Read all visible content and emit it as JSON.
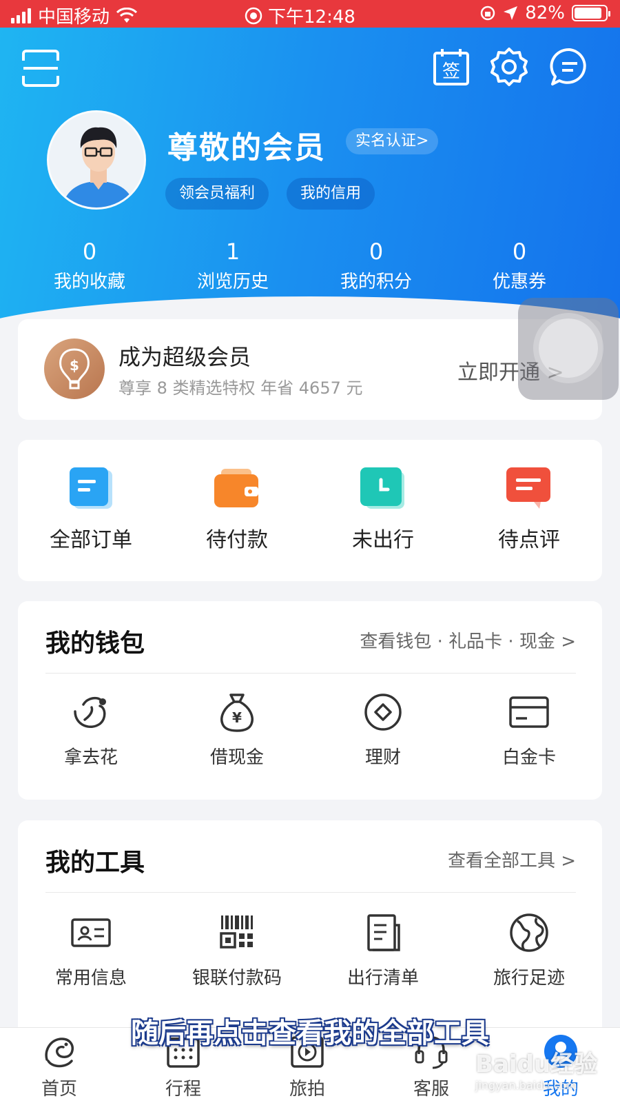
{
  "status_bar": {
    "carrier": "中国移动",
    "time": "下午12:48",
    "battery": "82%",
    "battery_level": 0.82
  },
  "header": {
    "scan_icon": "scan-icon",
    "sign_icon_label": "签",
    "username": "尊敬的会员",
    "realname_badge": "实名认证>",
    "pills": [
      "领会员福利",
      "我的信用"
    ],
    "stats": [
      {
        "value": "0",
        "label": "我的收藏"
      },
      {
        "value": "1",
        "label": "浏览历史"
      },
      {
        "value": "0",
        "label": "我的积分"
      },
      {
        "value": "0",
        "label": "优惠券"
      }
    ],
    "colors": {
      "gradient_start": "#1fb5f2",
      "gradient_end": "#1472ec",
      "status_bar": "#e8383d"
    }
  },
  "vip": {
    "title": "成为超级会员",
    "subtitle": "尊享 8 类精选特权 年省 4657 元",
    "action": "立即开通 >"
  },
  "orders": [
    {
      "label": "全部订单",
      "icon": "order-list-icon",
      "color": "#2aa4f4"
    },
    {
      "label": "待付款",
      "icon": "wallet-icon",
      "color": "#f7862a"
    },
    {
      "label": "未出行",
      "icon": "clock-icon",
      "color": "#1fc7b6"
    },
    {
      "label": "待点评",
      "icon": "comment-icon",
      "color": "#f0503c"
    }
  ],
  "wallet": {
    "title": "我的钱包",
    "link": "查看钱包 · 礼品卡 · 现金 >",
    "items": [
      {
        "label": "拿去花",
        "icon": "naquhua-icon"
      },
      {
        "label": "借现金",
        "icon": "money-bag-icon"
      },
      {
        "label": "理财",
        "icon": "finance-icon"
      },
      {
        "label": "白金卡",
        "icon": "card-icon"
      }
    ]
  },
  "tools": {
    "title": "我的工具",
    "link": "查看全部工具 >",
    "items": [
      {
        "label": "常用信息",
        "icon": "id-card-icon"
      },
      {
        "label": "银联付款码",
        "icon": "qr-code-icon"
      },
      {
        "label": "出行清单",
        "icon": "checklist-icon"
      },
      {
        "label": "旅行足迹",
        "icon": "globe-icon"
      }
    ]
  },
  "subtitle_overlay": "随后再点击查看我的全部工具",
  "tabbar": [
    {
      "label": "首页",
      "icon": "dolphin-icon"
    },
    {
      "label": "行程",
      "icon": "calendar-icon"
    },
    {
      "label": "旅拍",
      "icon": "video-icon"
    },
    {
      "label": "客服",
      "icon": "headset-icon"
    },
    {
      "label": "我的",
      "icon": "user-icon",
      "active": true
    }
  ],
  "watermark": {
    "brand": "Baidu经验",
    "url": "jingyan.baidu.com"
  }
}
